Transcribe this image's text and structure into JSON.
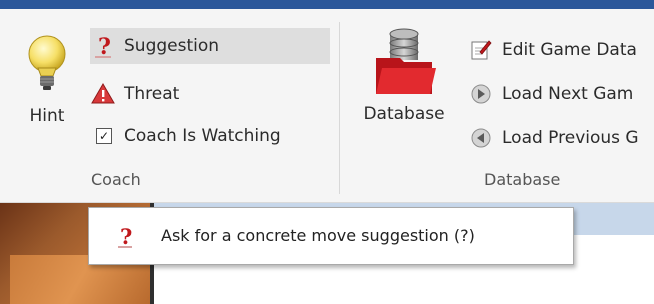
{
  "ribbon": {
    "coach_group": {
      "label": "Coach",
      "hint_label": "Hint",
      "suggestion_label": "Suggestion",
      "threat_label": "Threat",
      "coach_watching_label": "Coach Is Watching",
      "coach_watching_checked": true
    },
    "database_group": {
      "label": "Database",
      "database_label": "Database",
      "edit_game_data_label": "Edit Game Data",
      "load_next_game_label": "Load Next Gam",
      "load_previous_game_label": "Load Previous G"
    }
  },
  "tooltip": {
    "text": "Ask for a concrete move suggestion (?)"
  },
  "colors": {
    "title_bar": "#2b579a",
    "hover_highlight": "#dedede",
    "question_mark": "#c0181c",
    "threat_red": "#c0181c"
  }
}
